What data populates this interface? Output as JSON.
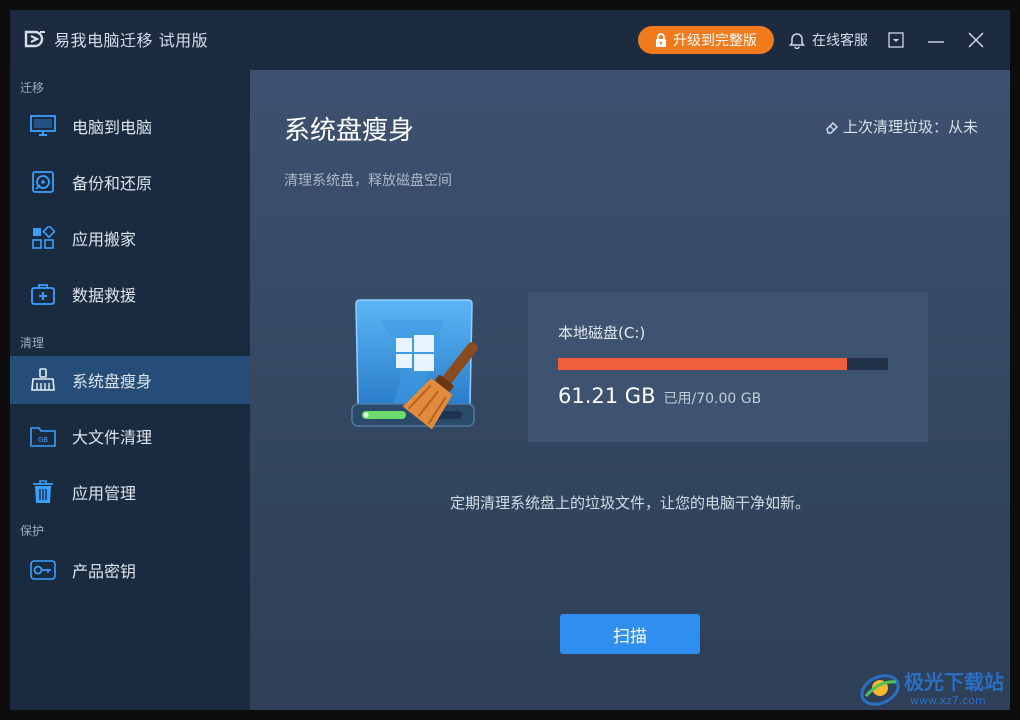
{
  "window": {
    "title": "易我电脑迁移 试用版"
  },
  "titlebar": {
    "upgrade_label": "升级到完整版",
    "support_label": "在线客服"
  },
  "sidebar": {
    "sections": {
      "migrate": "迁移",
      "clean": "清理",
      "protect": "保护"
    },
    "items": [
      {
        "label": "电脑到电脑",
        "icon": "monitor-icon"
      },
      {
        "label": "备份和还原",
        "icon": "backup-disc-icon"
      },
      {
        "label": "应用搬家",
        "icon": "apps-grid-icon"
      },
      {
        "label": "数据救援",
        "icon": "first-aid-kit-icon"
      },
      {
        "label": "系统盘瘦身",
        "icon": "broom-icon",
        "active": true
      },
      {
        "label": "大文件清理",
        "icon": "gb-folder-icon"
      },
      {
        "label": "应用管理",
        "icon": "trash-icon"
      },
      {
        "label": "产品密钥",
        "icon": "key-icon"
      }
    ]
  },
  "main": {
    "title": "系统盘瘦身",
    "subtitle": "清理系统盘，释放磁盘空间",
    "last_clean": "上次清理垃圾：从未",
    "disk": {
      "name": "本地磁盘(C:)",
      "used": "61.21 GB",
      "used_label": "已用",
      "total": "/70.00 GB",
      "used_gb": 61.21,
      "total_gb": 70.0
    },
    "hint": "定期清理系统盘上的垃圾文件，让您的电脑干净如新。",
    "scan_label": "扫描"
  },
  "watermark": {
    "text": "极光下载站",
    "url": "www.xz7.com"
  },
  "colors": {
    "accent": "#2f8ff0",
    "upgrade": "#f07a1c",
    "usage_bar": "#f0603c",
    "active_nav": "#264d78"
  }
}
